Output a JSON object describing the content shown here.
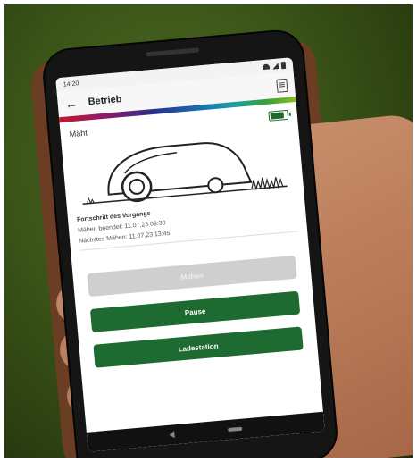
{
  "status_bar": {
    "time": "14:20"
  },
  "app_bar": {
    "title": "Betrieb",
    "back_icon": "arrow-left-icon",
    "doc_icon": "document-icon"
  },
  "accent_colors": [
    "#c21a2a",
    "#2a2f8a",
    "#1a6ab0",
    "#3aa030",
    "#1e6b32"
  ],
  "status": {
    "mode": "Mäht",
    "battery_level": 0.75
  },
  "info": {
    "line1": "Fortschritt des Vorgangs",
    "line2": "Mähen beendet: 11.07.23 09:30",
    "line3": "Nächstes Mähen: 11.07.23 13:45"
  },
  "buttons": {
    "mow": "Mähen",
    "pause": "Pause",
    "dock": "Ladestation"
  }
}
